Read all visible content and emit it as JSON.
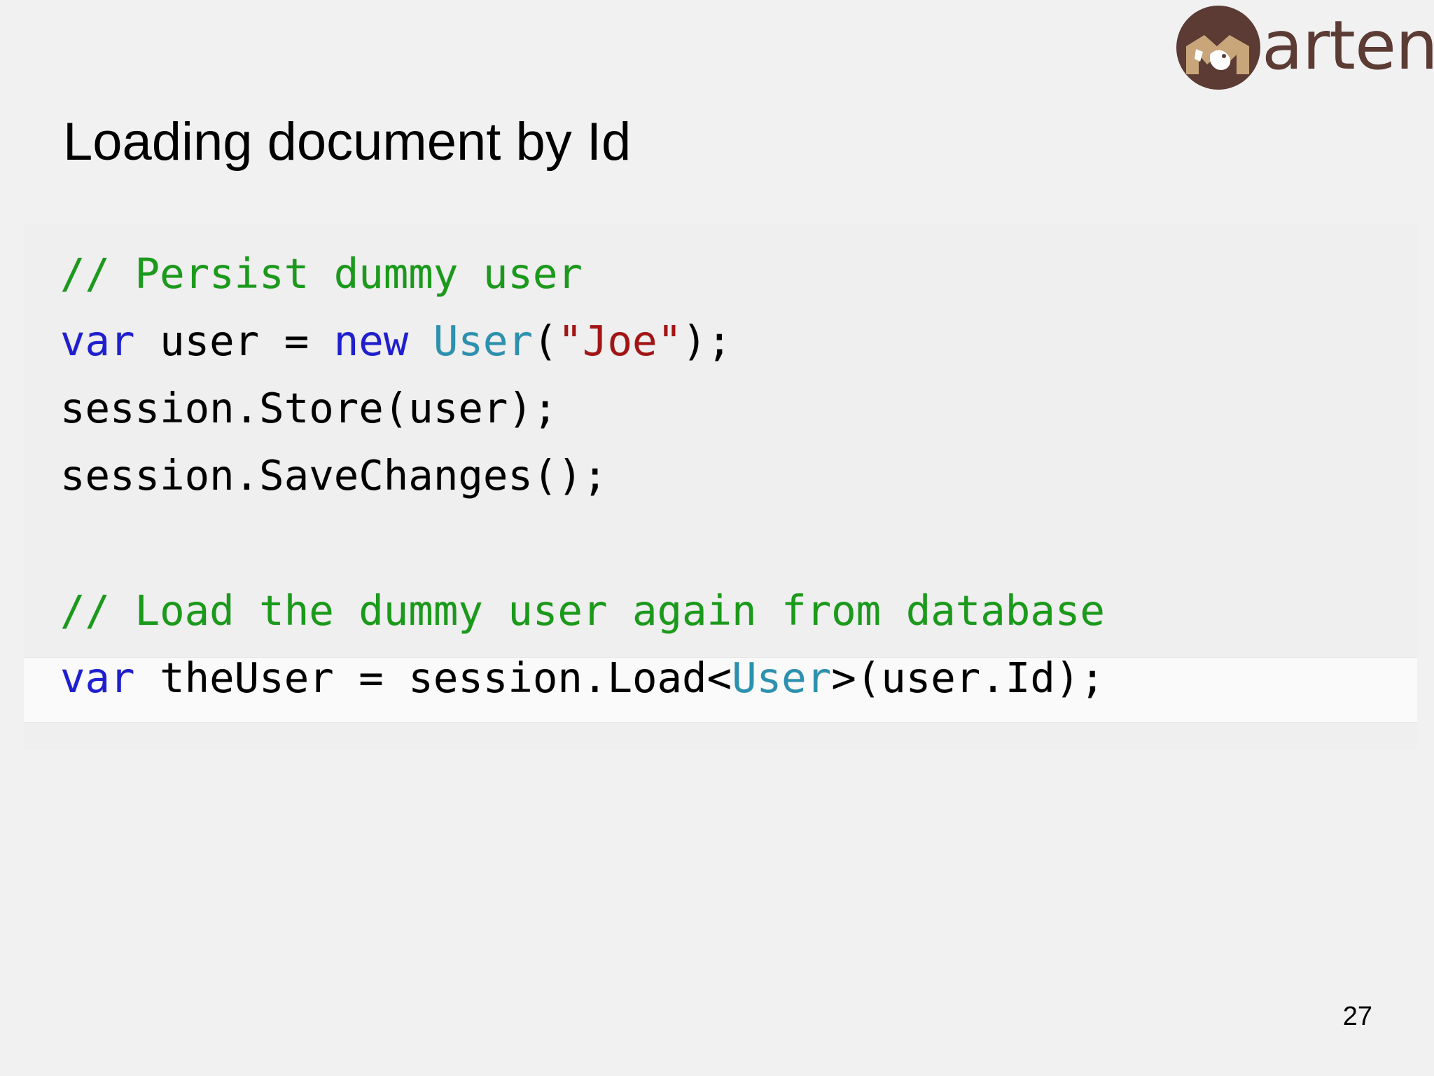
{
  "logo": {
    "word": "arten",
    "brand_color": "#5b3b34",
    "icon": "marten-animal-icon"
  },
  "title": "Loading document by Id",
  "code": {
    "line1": {
      "comment": "// Persist dummy user"
    },
    "line2": {
      "kw_var": "var",
      "id_user": " user = ",
      "kw_new": "new",
      "sp": " ",
      "type_user": "User",
      "open": "(",
      "str": "\"Joe\"",
      "close": ");"
    },
    "line3": {
      "text": "session.Store(user);"
    },
    "line4": {
      "text": "session.SaveChanges();"
    },
    "line6": {
      "comment": "// Load the dummy user again from database"
    },
    "line7": {
      "kw_var": "var",
      "mid": " theUser = session.Load<",
      "type_user": "User",
      "end": ">(user.Id);"
    }
  },
  "colors": {
    "comment": "#1a9a1a",
    "keyword": "#1f1fd0",
    "type": "#2b91af",
    "string": "#a31515"
  },
  "page_number": "27"
}
